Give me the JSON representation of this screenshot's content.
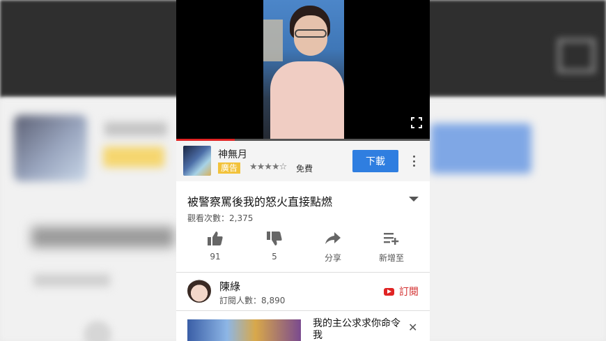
{
  "ad": {
    "app_name": "神無月",
    "badge": "廣告",
    "stars": "★★★★☆",
    "price": "免費",
    "download_label": "下載"
  },
  "video": {
    "title": "被警察罵後我的怒火直接點燃",
    "views": "觀看次數：2,375",
    "progress": 0.23
  },
  "actions": {
    "like_count": "91",
    "dislike_count": "5",
    "share_label": "分享",
    "add_label": "新增至"
  },
  "channel": {
    "name": "陳綠",
    "subscribers": "訂閱人數：8,890",
    "subscribe_label": "訂閱"
  },
  "next": {
    "title": "我的主公求求你命令我"
  },
  "colors": {
    "accent_blue": "#2f7ee0",
    "youtube_red": "#e02424",
    "badge_yellow": "#f2c23a"
  }
}
